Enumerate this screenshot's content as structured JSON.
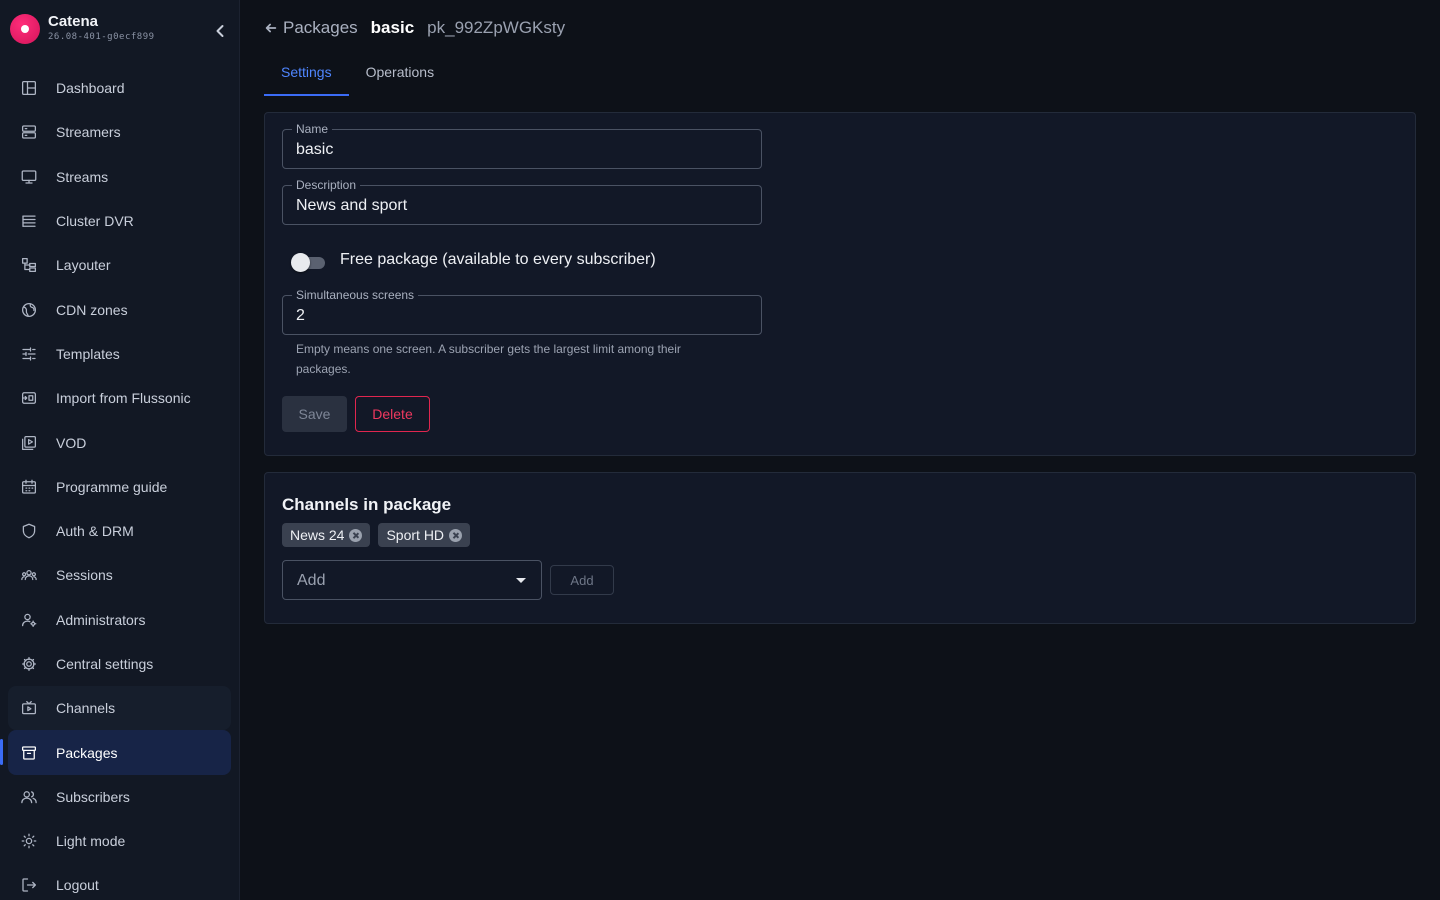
{
  "brand": {
    "name": "Catena",
    "version": "26.08-401-g0ecf899"
  },
  "sidebar": {
    "items": [
      {
        "label": "Dashboard",
        "icon": "dashboard-icon"
      },
      {
        "label": "Streamers",
        "icon": "server-icon"
      },
      {
        "label": "Streams",
        "icon": "monitor-icon"
      },
      {
        "label": "Cluster DVR",
        "icon": "storage-icon"
      },
      {
        "label": "Layouter",
        "icon": "layout-icon"
      },
      {
        "label": "CDN zones",
        "icon": "globe-icon"
      },
      {
        "label": "Templates",
        "icon": "sliders-icon"
      },
      {
        "label": "Import from Flussonic",
        "icon": "import-icon"
      },
      {
        "label": "VOD",
        "icon": "video-library-icon"
      },
      {
        "label": "Programme guide",
        "icon": "calendar-icon"
      },
      {
        "label": "Auth & DRM",
        "icon": "shield-icon"
      },
      {
        "label": "Sessions",
        "icon": "sessions-icon"
      },
      {
        "label": "Administrators",
        "icon": "admin-icon"
      },
      {
        "label": "Central settings",
        "icon": "gear-icon"
      },
      {
        "label": "Channels",
        "icon": "tv-icon"
      },
      {
        "label": "Packages",
        "icon": "archive-icon"
      },
      {
        "label": "Subscribers",
        "icon": "users-icon"
      },
      {
        "label": "Light mode",
        "icon": "sun-icon"
      },
      {
        "label": "Logout",
        "icon": "logout-icon"
      }
    ],
    "active": "Packages"
  },
  "breadcrumb": {
    "back_label": "Packages",
    "name": "basic",
    "id": "pk_992ZpWGKsty"
  },
  "tabs": [
    {
      "label": "Settings",
      "active": true
    },
    {
      "label": "Operations",
      "active": false
    }
  ],
  "settings": {
    "name_label": "Name",
    "name_value": "basic",
    "description_label": "Description",
    "description_value": "News and sport",
    "free_toggle_label": "Free package (available to every subscriber)",
    "free_toggle_on": false,
    "screens_label": "Simultaneous screens",
    "screens_value": "2",
    "screens_help": "Empty means one screen. A subscriber gets the largest limit among their packages.",
    "save_label": "Save",
    "delete_label": "Delete"
  },
  "channels": {
    "title": "Channels in package",
    "chips": [
      "News 24",
      "Sport HD"
    ],
    "select_placeholder": "Add",
    "add_label": "Add"
  },
  "colors": {
    "accent": "#3b6cf6",
    "danger": "#e0264f",
    "brand": "#e0185f"
  }
}
